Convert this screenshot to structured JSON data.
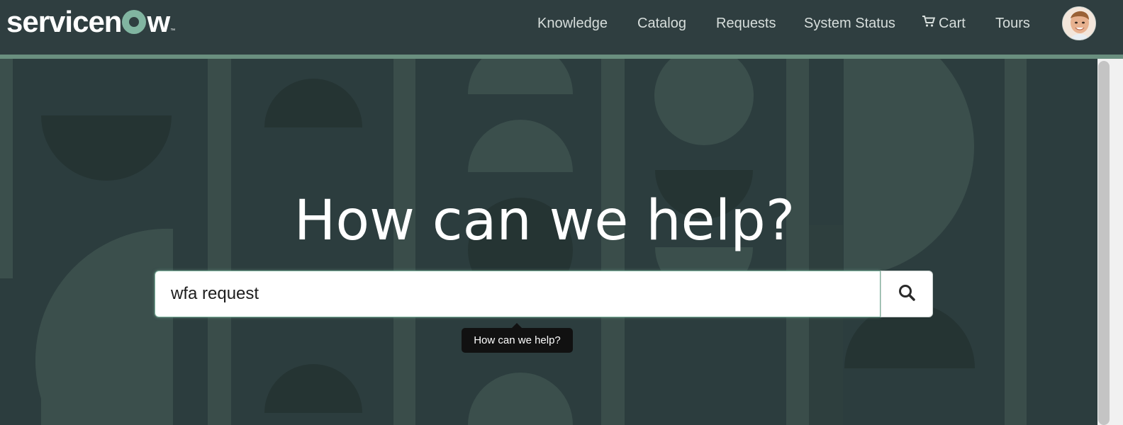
{
  "brand": {
    "logo_text_before": "servicen",
    "logo_text_after": "w",
    "trademark": "™"
  },
  "nav": {
    "items": [
      {
        "label": "Knowledge"
      },
      {
        "label": "Catalog"
      },
      {
        "label": "Requests"
      },
      {
        "label": "System Status"
      },
      {
        "label": "Cart",
        "icon": "cart-icon"
      },
      {
        "label": "Tours"
      }
    ]
  },
  "user": {
    "avatar": "user-avatar"
  },
  "hero": {
    "headline": "How can we help?",
    "search": {
      "value": "wfa request",
      "button_icon": "search-icon"
    },
    "tooltip": "How can we help?"
  },
  "colors": {
    "header_bg": "#2f3e40",
    "accent": "#81b5a1",
    "hero_bg": "#2c3d3e"
  }
}
